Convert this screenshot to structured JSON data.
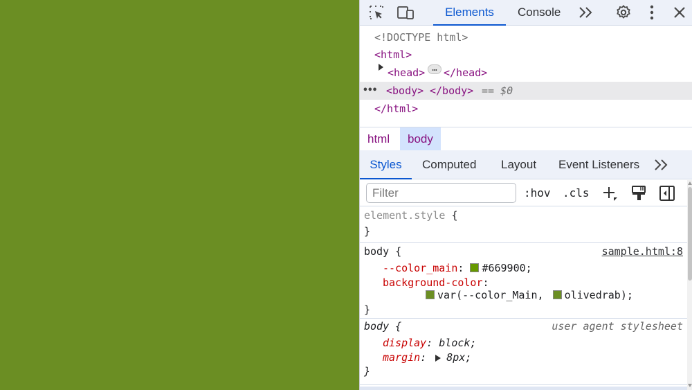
{
  "page": {
    "background": "#6b8e23"
  },
  "toolbar": {
    "icons": [
      "inspect-element-icon",
      "device-toolbar-icon",
      "more-tabs-icon",
      "settings-gear-icon",
      "kebab-menu-icon",
      "close-icon"
    ],
    "tabs": [
      {
        "label": "Elements",
        "active": true
      },
      {
        "label": "Console",
        "active": false
      }
    ]
  },
  "dom": {
    "doctype": "<!DOCTYPE html>",
    "html_open": "<html>",
    "head_open": "<head>",
    "head_close": "</head>",
    "body_open": "<body>",
    "body_close": "</body>",
    "body_ref": "== $0",
    "html_close": "</html>",
    "ellipsis": "…"
  },
  "breadcrumbs": [
    {
      "label": "html",
      "active": false
    },
    {
      "label": "body",
      "active": true
    }
  ],
  "styles_tabs": [
    {
      "label": "Styles",
      "active": true
    },
    {
      "label": "Computed",
      "active": false
    },
    {
      "label": "Layout",
      "active": false
    },
    {
      "label": "Event Listeners",
      "active": false
    }
  ],
  "filter": {
    "placeholder": "Filter",
    "hov": ":hov",
    "cls": ".cls"
  },
  "rules": {
    "element_style": {
      "selector": "element.style",
      "open": "{",
      "close": "}"
    },
    "body_rule": {
      "selector": "body",
      "open": "{",
      "close": "}",
      "source": "sample.html:8",
      "prop1": "--color_main",
      "val1": "#669900",
      "swatch1": "#669900",
      "prop2": "background-color",
      "val2_var": "var(--color_Main,",
      "swatch2": "#6b8e23",
      "val2_fallback": "olivedrab);",
      "swatch3": "#6b8e23"
    },
    "ua_rule": {
      "selector": "body",
      "open": "{",
      "close": "}",
      "source": "user agent stylesheet",
      "prop1": "display",
      "val1": "block;",
      "prop2": "margin",
      "val2": "8px;"
    }
  }
}
